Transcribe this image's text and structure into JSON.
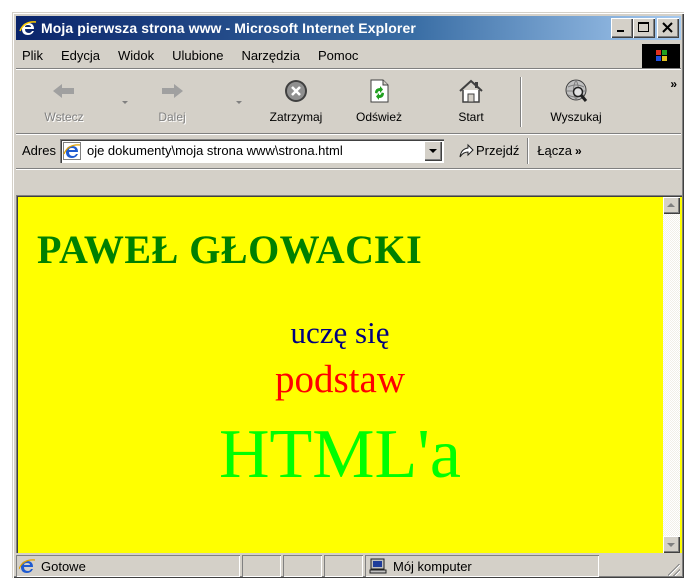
{
  "window": {
    "title": "Moja pierwsza strona www - Microsoft Internet Explorer"
  },
  "menu": {
    "items": [
      "Plik",
      "Edycja",
      "Widok",
      "Ulubione",
      "Narzędzia",
      "Pomoc"
    ]
  },
  "toolbar": {
    "back_label": "Wstecz",
    "forward_label": "Dalej",
    "stop_label": "Zatrzymaj",
    "refresh_label": "Odśwież",
    "home_label": "Start",
    "search_label": "Wyszukaj",
    "overflow": "»"
  },
  "address": {
    "label": "Adres",
    "value": "oje dokumenty\\moja strona www\\strona.html",
    "go_label": "Przejdź",
    "links_label": "Łącza",
    "links_overflow": "»"
  },
  "content": {
    "heading": "PAWEŁ GŁOWACKI",
    "line1": "uczę się",
    "line2": "podstaw",
    "line3": "HTML'a",
    "background_color": "#ffff00",
    "heading_color": "#008000",
    "line1_color": "#000080",
    "line2_color": "#ff0000",
    "line3_color": "#00ff00"
  },
  "status": {
    "text": "Gotowe",
    "zone": "Mój komputer"
  },
  "icons": {
    "title": "ie-icon",
    "back": "arrow-left-icon",
    "forward": "arrow-right-icon",
    "stop": "stop-icon",
    "refresh": "refresh-icon",
    "home": "home-icon",
    "search": "search-icon",
    "go": "go-arrow-icon",
    "zone": "computer-icon"
  }
}
